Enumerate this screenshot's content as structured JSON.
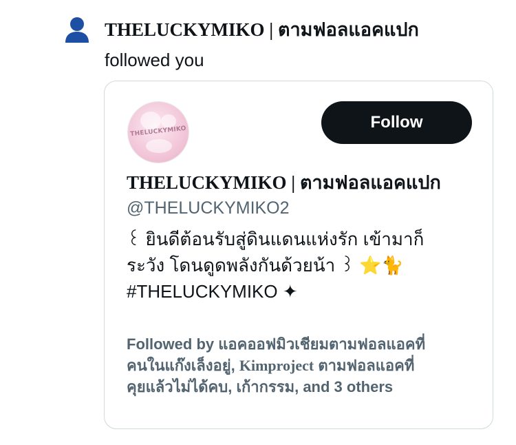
{
  "notification": {
    "icon": "person-icon",
    "title": "THELUCKYMIKO | ตามฟอลแอคแปก",
    "action_text": "followed you"
  },
  "card": {
    "avatar_text": "THELUCKYMIKO",
    "follow_button_label": "Follow",
    "display_name": "THELUCKYMIKO | ตามฟอลแอคแปก",
    "handle": "@THELUCKYMIKO2",
    "bio_lines": [
      "꒰ ยินดีต้อนรับสู่ดินแดนแห่งรัก เข้ามาก็",
      "ระวัง โดนดูดพลังกันด้วยน้า ꒱ ⭐️🐈",
      "#THELUCKYMIKO ✦"
    ],
    "followed_by": {
      "prefix": "Followed by ",
      "line1_rest": "แอคออฟมิวเชียมตามฟอลแอคที่",
      "line2_a": "คนในแก๊งเล็งอยู่, ",
      "line2_b": "Kimproject",
      "line2_c": " ตามฟอลแอคที่",
      "line3": "คุยแล้วไม่ได้คบ, เก้ากรรม, and 3 others"
    }
  },
  "colors": {
    "icon_blue": "#1d4fa3",
    "text_primary": "#0f1419",
    "text_secondary": "#536471",
    "button_bg": "#0f1419",
    "button_text": "#ffffff",
    "card_border": "#cfd9de"
  }
}
